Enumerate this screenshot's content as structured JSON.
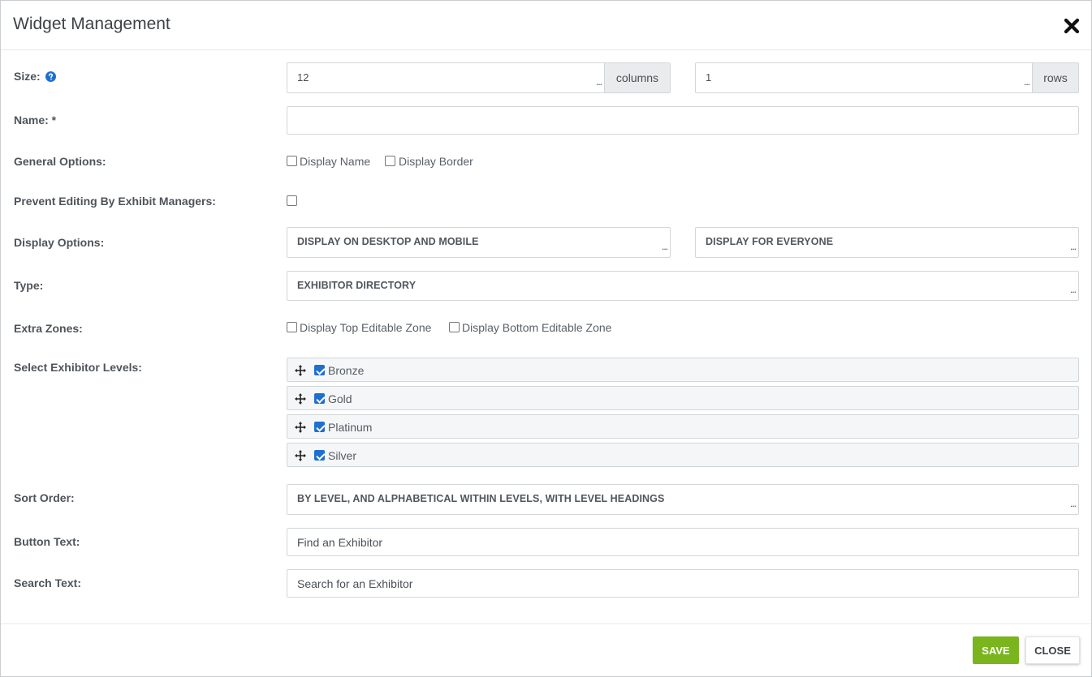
{
  "dialog": {
    "title": "Widget Management"
  },
  "form": {
    "size": {
      "label": "Size:",
      "columns_value": "12",
      "columns_addon": "columns",
      "rows_value": "1",
      "rows_addon": "rows"
    },
    "name": {
      "label": "Name: *",
      "value": ""
    },
    "general_options": {
      "label": "General Options:",
      "display_name": "Display Name",
      "display_name_checked": false,
      "display_border": "Display Border",
      "display_border_checked": false
    },
    "prevent_editing": {
      "label": "Prevent Editing By Exhibit Managers:",
      "checked": false
    },
    "display_options": {
      "label": "Display Options:",
      "device": "DISPLAY ON DESKTOP AND MOBILE",
      "audience": "DISPLAY FOR EVERYONE"
    },
    "type": {
      "label": "Type:",
      "value": "EXHIBITOR DIRECTORY"
    },
    "extra_zones": {
      "label": "Extra Zones:",
      "top": "Display Top Editable Zone",
      "top_checked": false,
      "bottom": "Display Bottom Editable Zone",
      "bottom_checked": false
    },
    "exhibitor_levels": {
      "label": "Select Exhibitor Levels:",
      "items": [
        {
          "label": "Bronze",
          "checked": true
        },
        {
          "label": "Gold",
          "checked": true
        },
        {
          "label": "Platinum",
          "checked": true
        },
        {
          "label": "Silver",
          "checked": true
        }
      ]
    },
    "sort_order": {
      "label": "Sort Order:",
      "value": "BY LEVEL, AND ALPHABETICAL WITHIN LEVELS, WITH LEVEL HEADINGS"
    },
    "button_text": {
      "label": "Button Text:",
      "value": "Find an Exhibitor"
    },
    "search_text": {
      "label": "Search Text:",
      "value": "Search for an Exhibitor"
    },
    "more_indicator": "..."
  },
  "footer": {
    "save_label": "SAVE",
    "close_label": "CLOSE"
  },
  "colors": {
    "save_button": "#7ab51d",
    "checkbox_checked": "#1f6fd1",
    "help_icon": "#1f6fd1"
  },
  "icons": {
    "close": "close-x-icon",
    "help": "question-circle-icon",
    "drag": "move-arrows-icon"
  }
}
